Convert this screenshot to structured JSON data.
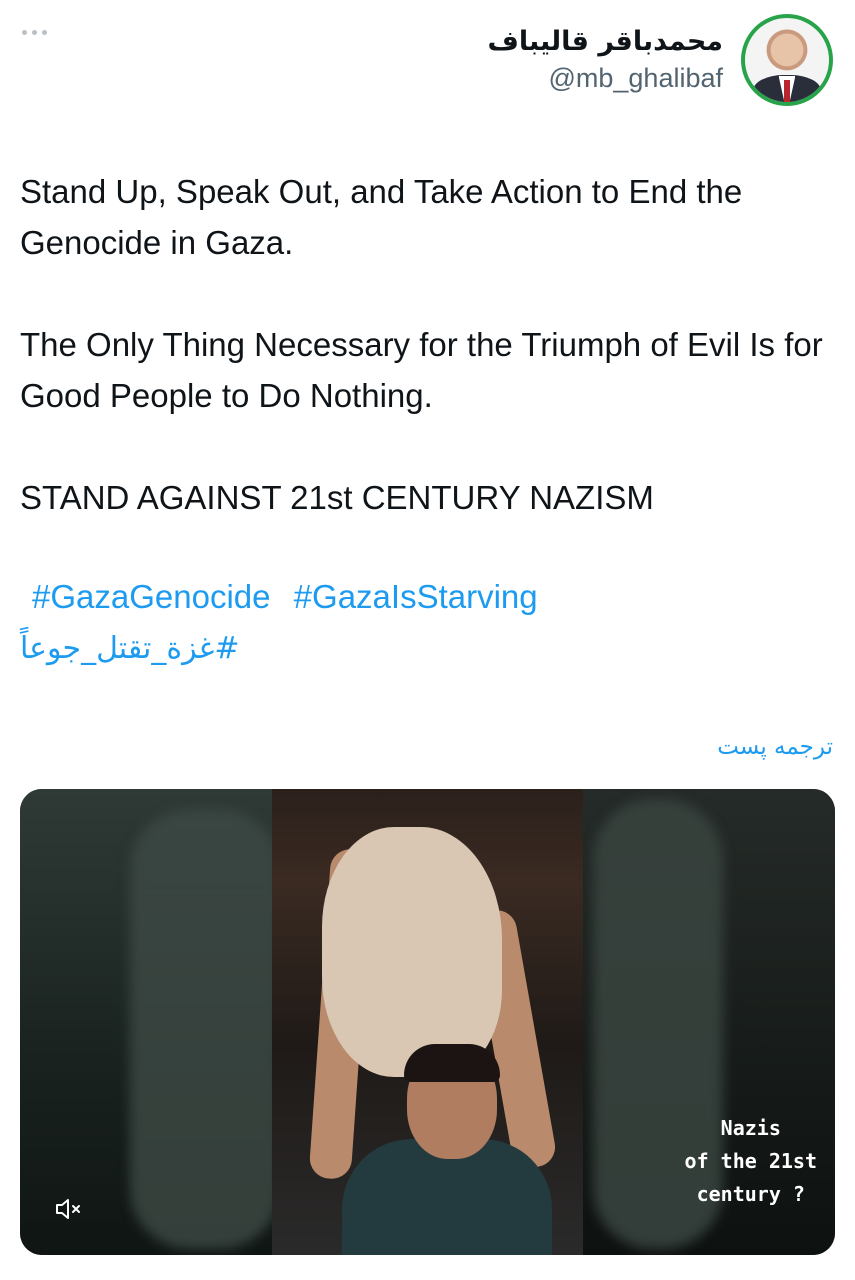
{
  "header": {
    "display_name": "محمدباقر قالیباف",
    "handle": "@mb_ghalibaf"
  },
  "tweet": {
    "text": "Stand Up, Speak Out, and Take Action to End the Genocide in Gaza.\n\nThe Only Thing Necessary for the Triumph of Evil Is for Good People to Do Nothing.\n\nSTAND AGAINST 21st CENTURY NAZISM",
    "hashtags": [
      "#GazaGenocide",
      "#GazaIsStarving",
      "#غزة_تقتل_جوعاً"
    ],
    "translate_label": "ترجمه پست"
  },
  "media": {
    "overlay_caption": "Nazis\nof the 21st\ncentury ?",
    "muted": true
  },
  "icons": {
    "more": "more-horizontal-icon",
    "mute": "speaker-muted-icon"
  }
}
